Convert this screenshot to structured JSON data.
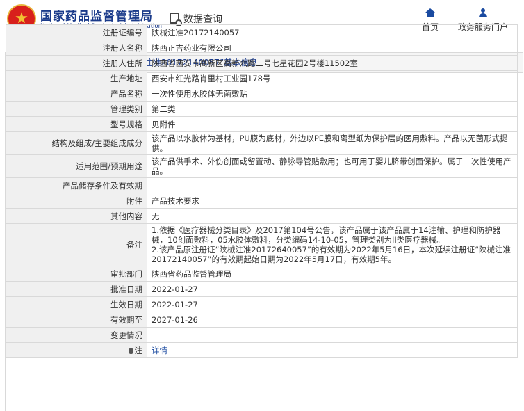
{
  "site": {
    "title": "国家药品监督管理局",
    "subtitle": "National Medical Products Administration",
    "search_label": "数据查询",
    "nav": [
      {
        "label": "首页",
        "icon": "home-icon"
      },
      {
        "label": "政务服务门户",
        "icon": "user-icon"
      }
    ]
  },
  "panel": {
    "title": "境内医疗器械（注册） ——“陕械注准20172140057”基本信息"
  },
  "rows": [
    {
      "key": "注册证编号",
      "value": "陕械注准20172140057"
    },
    {
      "key": "注册人名称",
      "value": "陕西正吉药业有限公司"
    },
    {
      "key": "注册人住所",
      "value": "陕西省西安市高新区高新六路二号七星花园2号楼11502室"
    },
    {
      "key": "生产地址",
      "value": "西安市红光路肖里村工业园178号"
    },
    {
      "key": "产品名称",
      "value": "一次性使用水胶体无菌敷贴"
    },
    {
      "key": "管理类别",
      "value": "第二类"
    },
    {
      "key": "型号规格",
      "value": "见附件"
    },
    {
      "key": "结构及组成/主要组成成分",
      "value": "该产品以水胶体为基材，PU膜为底材，外边以PE膜和离型纸为保护层的医用敷料。产品以无菌形式提供。"
    },
    {
      "key": "适用范围/预期用途",
      "value": "该产品供手术、外伤创面或留置动、静脉导管贴敷用；也可用于婴儿脐带创面保护。属于一次性使用产品。"
    },
    {
      "key": "产品储存条件及有效期",
      "value": ""
    },
    {
      "key": "附件",
      "value": "产品技术要求"
    },
    {
      "key": "其他内容",
      "value": "无"
    },
    {
      "key": "备注",
      "value": "1.依据《医疗器械分类目录》及2017第104号公告，该产品属于该产品属于14注输、护理和防护器械，10创面敷料，05水胶体敷料，分类编码14-10-05，管理类别为II类医疗器械。\n2.该产品原注册证“陕械注准20172640057”的有效期为2022年5月16日，本次延续注册证“陕械注准20172140057”的有效期起始日期为2022年5月17日，有效期5年。"
    },
    {
      "key": "审批部门",
      "value": "陕西省药品监督管理局"
    },
    {
      "key": "批准日期",
      "value": "2022-01-27"
    },
    {
      "key": "生效日期",
      "value": "2022-01-27"
    },
    {
      "key": "有效期至",
      "value": "2027-01-26"
    },
    {
      "key": "变更情况",
      "value": ""
    }
  ],
  "note_row": {
    "key": "注",
    "value": "详情"
  }
}
